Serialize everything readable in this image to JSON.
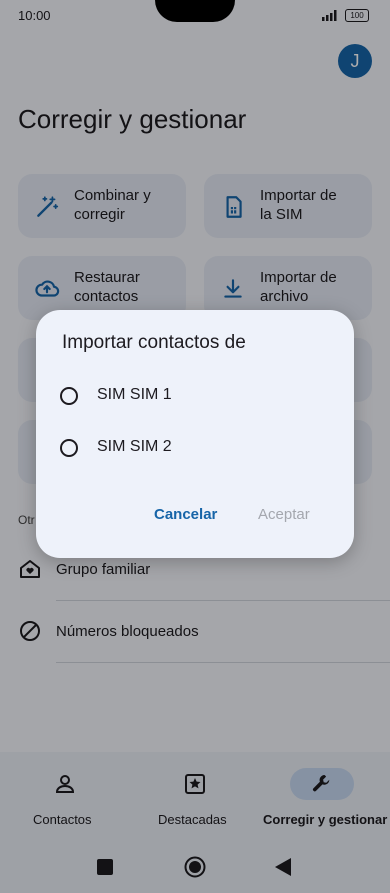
{
  "status_bar": {
    "time": "10:00",
    "battery": "100"
  },
  "account": {
    "avatar_letter": "J"
  },
  "page_title": "Corregir y gestionar",
  "tiles": [
    {
      "line1": "Combinar y",
      "line2": "corregir",
      "icon": "magic-wand-icon"
    },
    {
      "line1": "Importar de",
      "line2": "la SIM",
      "icon": "sim-card-icon"
    },
    {
      "line1": "Restaurar",
      "line2": "contactos",
      "icon": "cloud-upload-icon"
    },
    {
      "line1": "Importar de",
      "line2": "archivo",
      "icon": "download-icon"
    }
  ],
  "other_section": {
    "label": "Otr"
  },
  "list": [
    {
      "label": "Grupo familiar",
      "icon": "family-home-icon"
    },
    {
      "label": "Números bloqueados",
      "icon": "block-icon"
    }
  ],
  "dialog": {
    "title": "Importar contactos de",
    "options": [
      "SIM SIM 1",
      "SIM SIM 2"
    ],
    "cancel_label": "Cancelar",
    "accept_label": "Aceptar"
  },
  "bottom_nav": [
    {
      "label": "Contactos",
      "icon": "person-icon",
      "active": false
    },
    {
      "label": "Destacadas",
      "icon": "star-box-icon",
      "active": false
    },
    {
      "label": "Corregir y gestionar",
      "icon": "wrench-icon",
      "active": true
    }
  ],
  "colors": {
    "accent": "#1765a8",
    "tile_bg": "#e3e8f3",
    "dialog_bg": "#eef2fa",
    "active_pill": "#c6d8f0"
  }
}
